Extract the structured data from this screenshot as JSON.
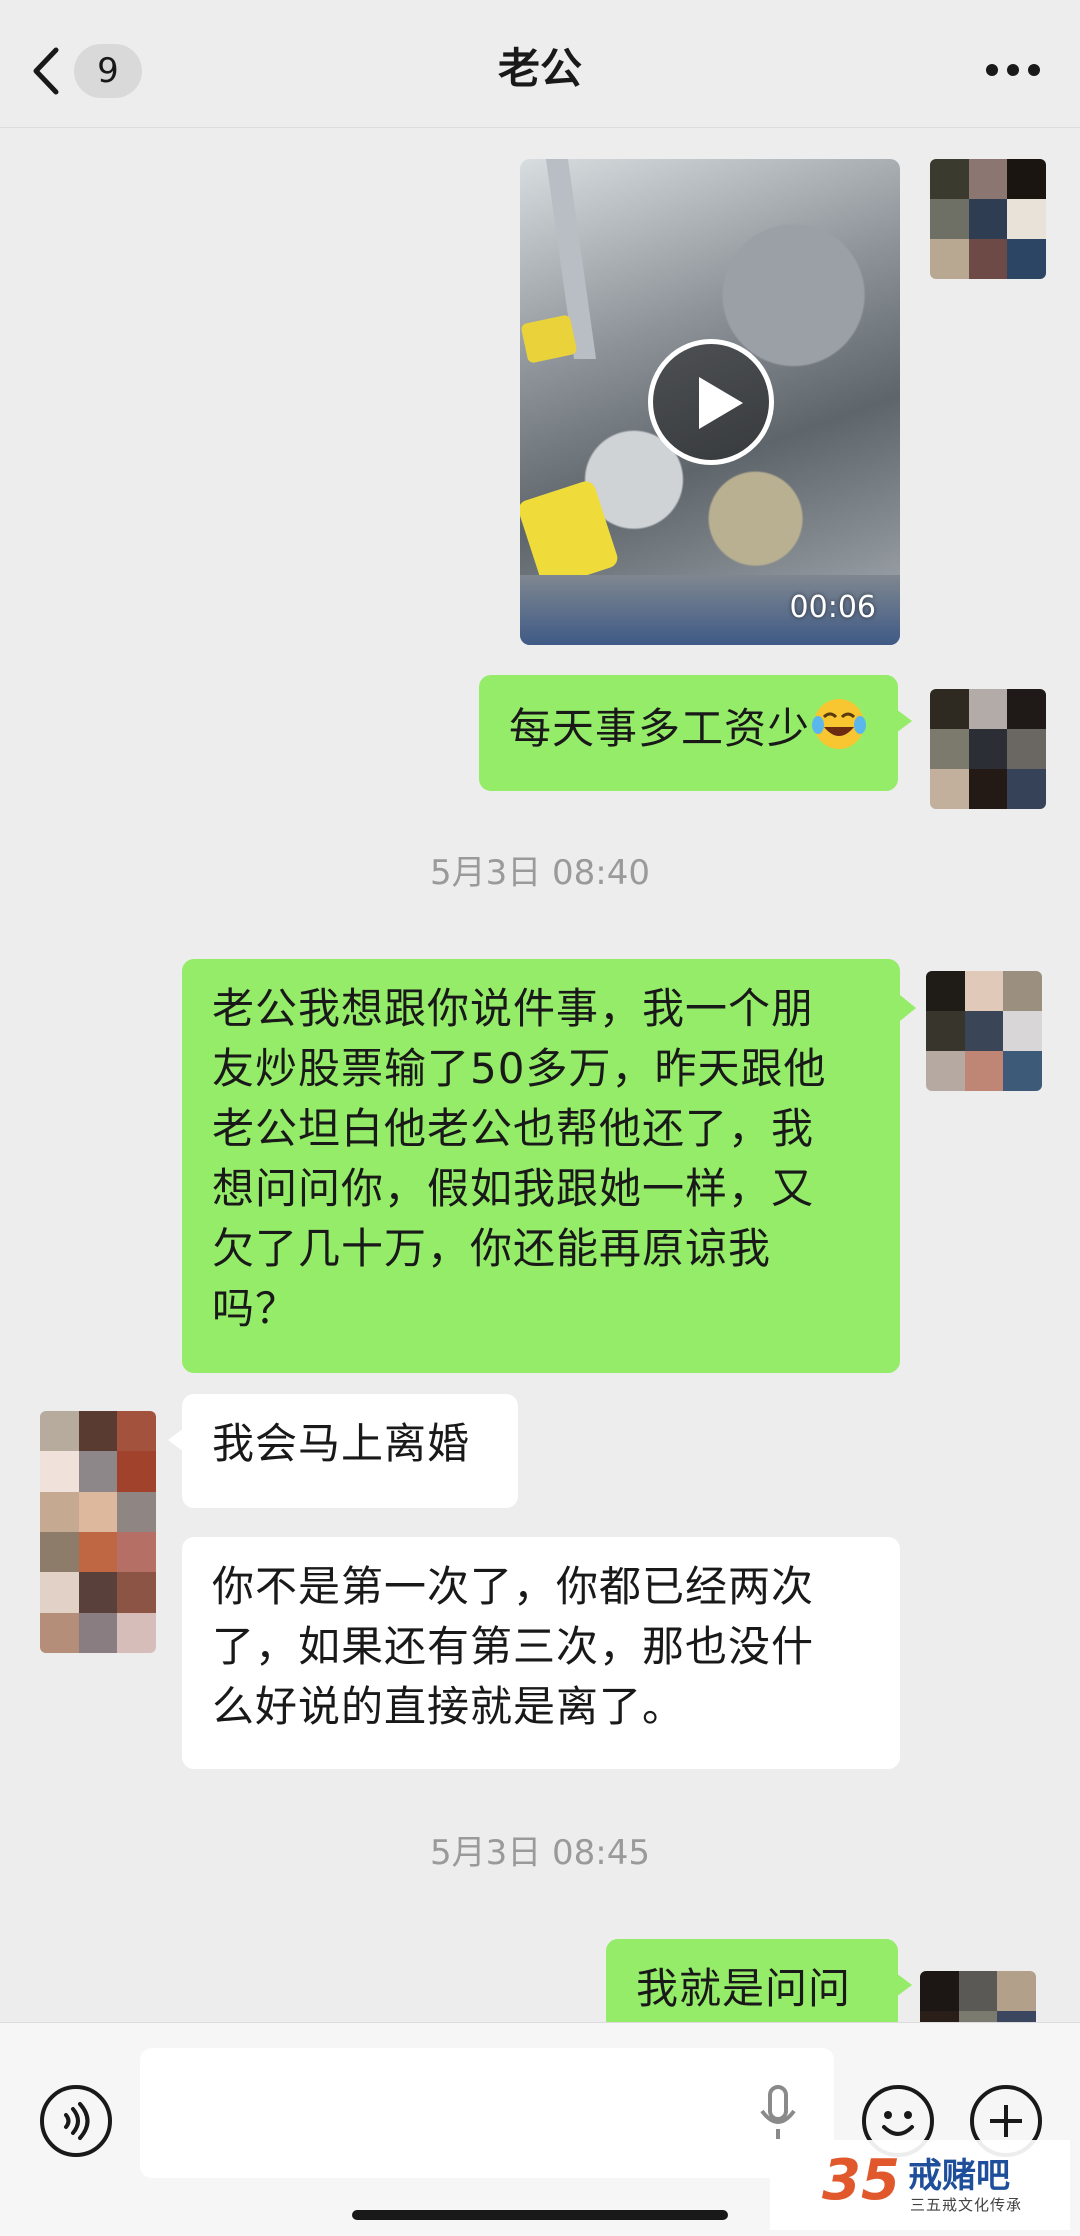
{
  "header": {
    "back_label": "",
    "unread_count": "9",
    "title": "老公",
    "more_icon": "more-dots-icon"
  },
  "chat": {
    "video_message": {
      "duration": "00:06",
      "sender": "me"
    },
    "messages": [
      {
        "sender": "me",
        "text": "每天事多工资少",
        "emoji": "laughing-tears-emoji"
      },
      {
        "type": "timestamp",
        "text": "5月3日 08:40"
      },
      {
        "sender": "me",
        "lines": [
          "老公我想跟你说件事，我一个朋",
          "友炒股票输了50多万，昨天跟他",
          "老公坦白他老公也帮他还了，我",
          "想问问你，假如我跟她一样，又",
          "欠了几十万，你还能再原谅我",
          "吗？"
        ]
      },
      {
        "sender": "other",
        "text": "我会马上离婚"
      },
      {
        "sender": "other",
        "lines": [
          "你不是第一次了，你都已经两次",
          "了，如果还有第三次，那也没什",
          "么好说的直接就是离了。"
        ]
      },
      {
        "type": "timestamp",
        "text": "5月3日 08:45"
      },
      {
        "sender": "me",
        "text": "我就是问问"
      }
    ]
  },
  "input_bar": {
    "placeholder": "",
    "voice_icon": "voice-icon",
    "mic_icon": "microphone-icon",
    "emoji_icon": "emoji-icon",
    "plus_icon": "plus-icon"
  },
  "watermark": {
    "number": "35",
    "name": "戒赌吧",
    "subtitle": "三五戒文化传承"
  },
  "colors": {
    "background": "#ededed",
    "my_bubble": "#95ec69",
    "other_bubble": "#ffffff",
    "timestamp": "#9a9a9a"
  }
}
